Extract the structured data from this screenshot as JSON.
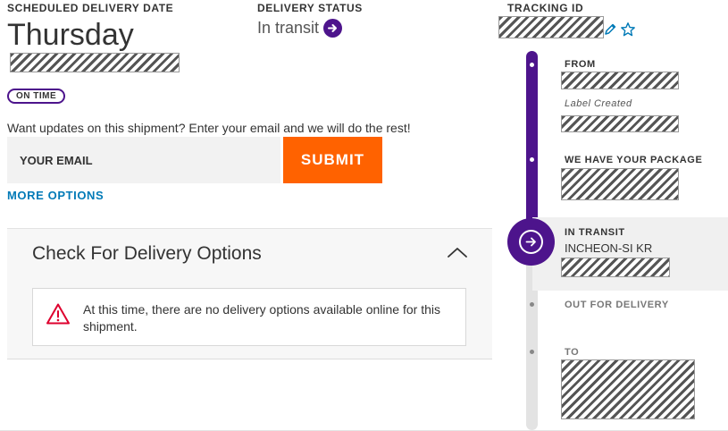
{
  "header": {
    "scheduled_label": "SCHEDULED DELIVERY DATE",
    "day": "Thursday",
    "status_label": "DELIVERY STATUS",
    "status_value": "In transit",
    "tracking_label": "TRACKING ID"
  },
  "badge": {
    "on_time": "ON TIME"
  },
  "email_updates": {
    "prompt": "Want updates on this shipment? Enter your email and we will do the rest!",
    "placeholder": "YOUR EMAIL",
    "submit_label": "SUBMIT",
    "more_options": "MORE OPTIONS"
  },
  "delivery_options": {
    "title": "Check For Delivery Options",
    "notice": "At this time, there are no delivery options available online for this shipment."
  },
  "timeline": {
    "from_label": "FROM",
    "label_created": "Label Created",
    "have_package": "WE HAVE YOUR PACKAGE",
    "in_transit": "IN TRANSIT",
    "in_transit_location": "INCHEON-SI KR",
    "out_for_delivery": "OUT FOR DELIVERY",
    "to_label": "TO"
  },
  "colors": {
    "brand_purple": "#4d148c",
    "submit_orange": "#ff6200",
    "link_blue": "#007ab7",
    "warning_red": "#de002e"
  },
  "icons": [
    "arrow-right-icon",
    "pencil-icon",
    "star-icon",
    "chevron-up-icon",
    "warning-icon"
  ]
}
